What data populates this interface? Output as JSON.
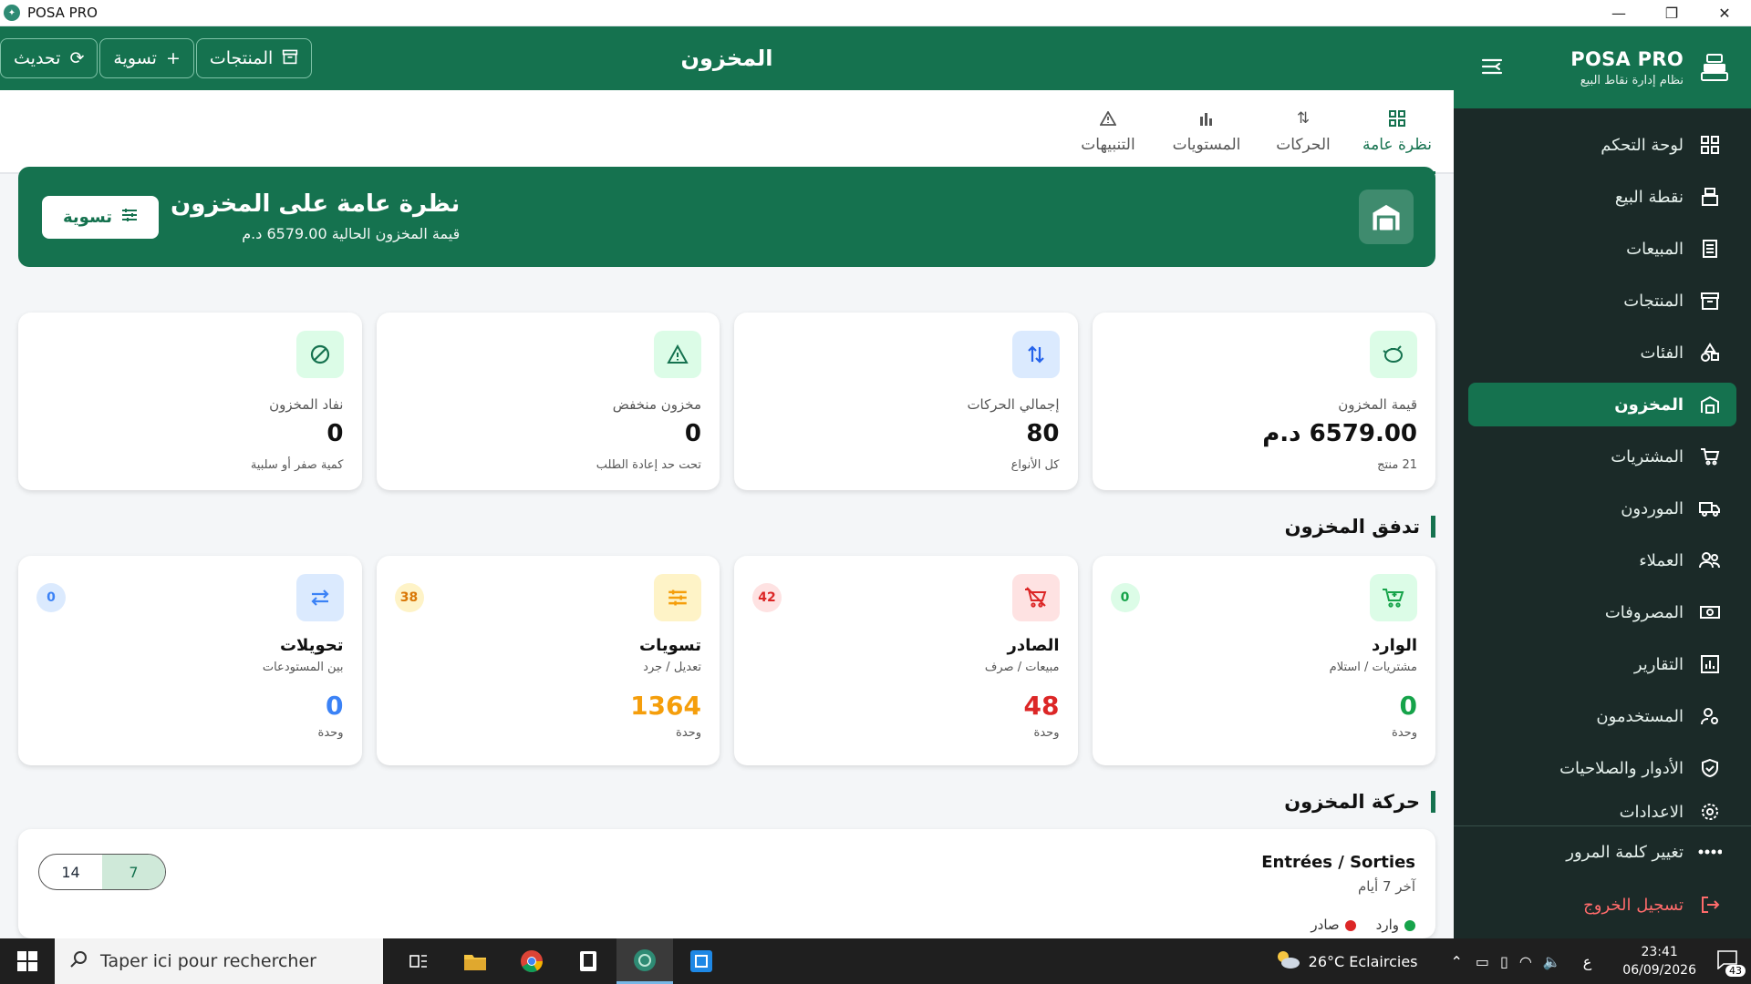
{
  "window": {
    "title": "POSA PRO"
  },
  "sidebar": {
    "brand": "POSA PRO",
    "subtitle": "نظام إدارة نقاط البيع",
    "items": [
      {
        "label": "لوحة التحكم",
        "icon": "dashboard-icon"
      },
      {
        "label": "نقطة البيع",
        "icon": "cash-register-icon"
      },
      {
        "label": "المبيعات",
        "icon": "receipt-icon"
      },
      {
        "label": "المنتجات",
        "icon": "archive-icon"
      },
      {
        "label": "الفئات",
        "icon": "shapes-icon"
      },
      {
        "label": "المخزون",
        "icon": "warehouse-icon",
        "active": true
      },
      {
        "label": "المشتريات",
        "icon": "cart-icon"
      },
      {
        "label": "الموردون",
        "icon": "truck-icon"
      },
      {
        "label": "العملاء",
        "icon": "users-icon"
      },
      {
        "label": "المصروفات",
        "icon": "money-icon"
      },
      {
        "label": "التقارير",
        "icon": "report-icon"
      },
      {
        "label": "المستخدمون",
        "icon": "user-gear-icon"
      },
      {
        "label": "الأدوار والصلاحيات",
        "icon": "shield-icon"
      },
      {
        "label": "الاعدادات",
        "icon": "gear-icon"
      }
    ],
    "change_password": "تغيير كلمة المرور",
    "logout": "تسجيل الخروج"
  },
  "header": {
    "title": "المخزون",
    "btn_products": "المنتجات",
    "btn_adjust": "تسوية",
    "btn_refresh": "تحديث"
  },
  "tabs": [
    {
      "label": "نظرة عامة"
    },
    {
      "label": "الحركات"
    },
    {
      "label": "المستويات"
    },
    {
      "label": "التنبيهات"
    }
  ],
  "banner": {
    "title": "نظرة عامة على المخزون",
    "subtitle": "قيمة المخزون الحالية 6579.00 د.م",
    "button": "تسوية"
  },
  "stats": [
    {
      "label": "قيمة المخزون",
      "value": "6579.00 د.م",
      "sub": "21 منتج"
    },
    {
      "label": "إجمالي الحركات",
      "value": "80",
      "sub": "كل الأنواع"
    },
    {
      "label": "مخزون منخفض",
      "value": "0",
      "sub": "تحت حد إعادة الطلب"
    },
    {
      "label": "نفاد المخزون",
      "value": "0",
      "sub": "كمية صفر أو سلبية"
    }
  ],
  "flow_title": "تدفق المخزون",
  "flow": [
    {
      "label": "الوارد",
      "sub": "مشتريات / استلام",
      "value": "0",
      "unit": "وحدة",
      "badge": "0"
    },
    {
      "label": "الصادر",
      "sub": "مبيعات / صرف",
      "value": "48",
      "unit": "وحدة",
      "badge": "42"
    },
    {
      "label": "تسويات",
      "sub": "تعديل / جرد",
      "value": "1364",
      "unit": "وحدة",
      "badge": "38"
    },
    {
      "label": "تحويلات",
      "sub": "بين المستودعات",
      "value": "0",
      "unit": "وحدة",
      "badge": "0"
    }
  ],
  "movement_title": "حركة المخزون",
  "chart": {
    "title": "Entrées / Sorties",
    "subtitle": "آخر 7 أيام",
    "toggle_a": "7",
    "toggle_b": "14",
    "legend_in": "وارد",
    "legend_out": "صادر"
  },
  "colors": {
    "primary": "#15724f",
    "sidebar": "#1b2a28",
    "in": "#16a34a",
    "out": "#dc2626",
    "adjust": "#f59e0b",
    "transfer": "#3b82f6"
  },
  "taskbar": {
    "search_placeholder": "Taper ici pour rechercher",
    "weather": "26°C Eclaircies",
    "lang": "ع",
    "time": "23:41",
    "date": "06/09/2026",
    "notif": "43"
  }
}
